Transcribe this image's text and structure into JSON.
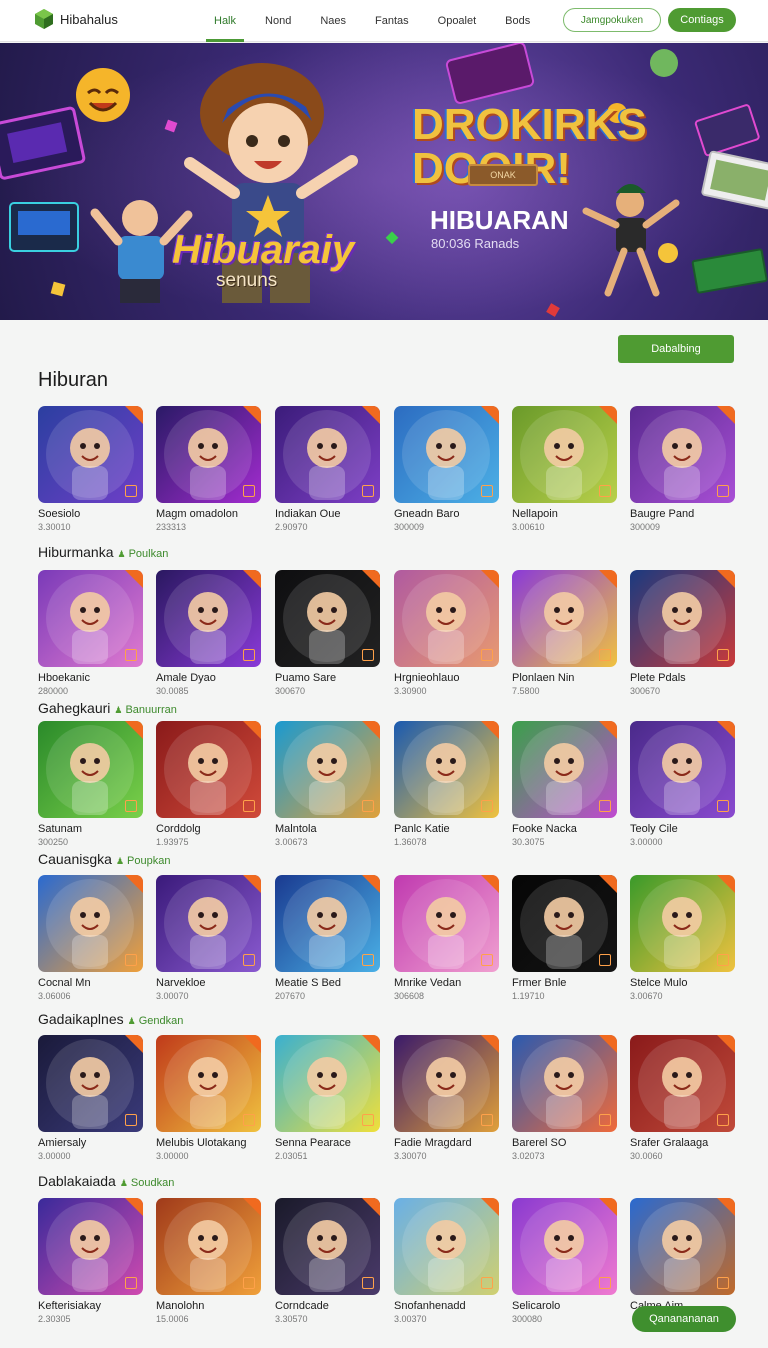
{
  "logo": {
    "name": "Hibahalus",
    "color": "#4f9b32"
  },
  "nav": {
    "items": [
      "Halk",
      "Nond",
      "Naes",
      "Fantas",
      "Opoalet",
      "Bods"
    ],
    "active_index": 0
  },
  "header_buttons": {
    "outline": "Jamgpokuken",
    "solid": "Contiags"
  },
  "hero": {
    "left_title": "Hibuaraiy",
    "left_sub": "senuns",
    "big_title_1": "DROKIRKS",
    "big_title_2": "DOOIR!",
    "sign": "ONAK",
    "title": "HIBUARAN",
    "subtitle": "80:036 Ranads",
    "colors": {
      "bg": "#3c2a76",
      "accent": "#f0c23f"
    }
  },
  "action_button": "Dabalbing",
  "main_title": "Hiburan",
  "sections": [
    {
      "title": "",
      "tag": "",
      "items": [
        {
          "name": "Soesiolo",
          "meta": "3.30010",
          "colors": [
            "#2b3fa0",
            "#6f3fc8"
          ],
          "art": "cursor-arrow"
        },
        {
          "name": "Magm omadolon",
          "meta": "233313",
          "colors": [
            "#2a1a66",
            "#a32cd0"
          ],
          "art": "galaxy-orb"
        },
        {
          "name": "Indiakan Oue",
          "meta": "2.90970",
          "colors": [
            "#3b1c7a",
            "#7e3fc6"
          ],
          "art": "cat-kid"
        },
        {
          "name": "Gneadn Baro",
          "meta": "300009",
          "colors": [
            "#2c6cc1",
            "#4cb0e6"
          ],
          "art": "NOSLUK"
        },
        {
          "name": "Nellapoin",
          "meta": "3.00610",
          "colors": [
            "#6a9a2a",
            "#b9d04a"
          ],
          "art": "boy"
        },
        {
          "name": "Baugre Pand",
          "meta": "300009",
          "colors": [
            "#5a2a90",
            "#a94fd6"
          ],
          "art": "kid-hat"
        }
      ]
    },
    {
      "title": "Hiburmanka",
      "tag": "Poulkan",
      "items": [
        {
          "name": "Hboekanic",
          "meta": "280000",
          "colors": [
            "#7a3ab8",
            "#e07ad0"
          ],
          "art": "boy-cat"
        },
        {
          "name": "Amale Dyao",
          "meta": "30.0085",
          "colors": [
            "#2a1860",
            "#8a3ad8"
          ],
          "art": "bear-face"
        },
        {
          "name": "Puamo Sare",
          "meta": "300670",
          "colors": [
            "#0e0e10",
            "#222"
          ],
          "art": "crayon"
        },
        {
          "name": "Hrgnieohlauo",
          "meta": "3.30900",
          "colors": [
            "#b05aa0",
            "#e89a70"
          ],
          "art": "runner"
        },
        {
          "name": "Plonlaen Nin",
          "meta": "7.5800",
          "colors": [
            "#8a3ad8",
            "#f0c23f"
          ],
          "art": "BANEPDNG"
        },
        {
          "name": "Plete Pdals",
          "meta": "300670",
          "colors": [
            "#1a3a80",
            "#c93a3a"
          ],
          "art": "guitar-kid"
        }
      ]
    },
    {
      "title": "Gahegkauri",
      "tag": "Banuurran",
      "items": [
        {
          "name": "Satunam",
          "meta": "300250",
          "colors": [
            "#2a8a2a",
            "#7ad04a"
          ],
          "art": "Vrghees"
        },
        {
          "name": "Corddolg",
          "meta": "1.93975",
          "colors": [
            "#8a1a1a",
            "#d04a3a"
          ],
          "art": "cat-girl"
        },
        {
          "name": "Malntola",
          "meta": "3.00673",
          "colors": [
            "#1a9ad0",
            "#e0a03a"
          ],
          "art": "Miove Daksor"
        },
        {
          "name": "Panlc Katie",
          "meta": "1.36078",
          "colors": [
            "#1a5ab0",
            "#f0c23f"
          ],
          "art": "WAIRED"
        },
        {
          "name": "Fooke Nacka",
          "meta": "30.3075",
          "colors": [
            "#3aa04a",
            "#c04ad0"
          ],
          "art": "Cire Case"
        },
        {
          "name": "Teoly Cile",
          "meta": "3.00000",
          "colors": [
            "#4a2a8a",
            "#8a4ad0"
          ],
          "art": "WAARE"
        }
      ]
    },
    {
      "title": "Cauanisgka",
      "tag": "Poupkan",
      "items": [
        {
          "name": "Cocnal Mn",
          "meta": "3.06006",
          "colors": [
            "#2a6ad0",
            "#f0a03a"
          ],
          "art": "bear-big"
        },
        {
          "name": "Narvekloe",
          "meta": "3.00070",
          "colors": [
            "#3a1a7a",
            "#8a5ad0"
          ],
          "art": "kid-wave"
        },
        {
          "name": "Meatie S Bed",
          "meta": "207670",
          "colors": [
            "#1a3a90",
            "#4ab0e6"
          ],
          "art": "blue-creature"
        },
        {
          "name": "Mnrike Vedan",
          "meta": "306608",
          "colors": [
            "#c03ab0",
            "#f0a0d0"
          ],
          "art": "orange-bear"
        },
        {
          "name": "Frmer Bnle",
          "meta": "1.19710",
          "colors": [
            "#060606",
            "#141414"
          ],
          "art": "BMCAMS"
        },
        {
          "name": "Stelce Mulo",
          "meta": "3.00670",
          "colors": [
            "#3a9a2a",
            "#f0c23f"
          ],
          "art": "Nelvexx"
        }
      ]
    },
    {
      "title": "Gadaikaplnes",
      "tag": "Gendkan",
      "items": [
        {
          "name": "Amiersaly",
          "meta": "3.00000",
          "colors": [
            "#1a1a3a",
            "#3a3a7a"
          ],
          "art": "Galerlcdo"
        },
        {
          "name": "Melubis Ulotakang",
          "meta": "3.00000",
          "colors": [
            "#c03a1a",
            "#f0c23f"
          ],
          "art": "Nelhunes"
        },
        {
          "name": "Senna Pearace",
          "meta": "2.03051",
          "colors": [
            "#3ab0d0",
            "#f0e03a"
          ],
          "art": "WAAAC"
        },
        {
          "name": "Fadie Mragdard",
          "meta": "3.30070",
          "colors": [
            "#3a1a6a",
            "#e0a03a"
          ],
          "art": "Hiivis"
        },
        {
          "name": "Barerel SO",
          "meta": "3.02073",
          "colors": [
            "#2a5ab0",
            "#f06a3a"
          ],
          "art": "kid-city"
        },
        {
          "name": "Srafer Gralaaga",
          "meta": "30.0060",
          "colors": [
            "#8a1a1a",
            "#c04a3a"
          ],
          "art": "kid-dark"
        }
      ]
    },
    {
      "title": "Dablakaiada",
      "tag": "Soudkan",
      "items": [
        {
          "name": "Kefterisiakay",
          "meta": "2.30305",
          "colors": [
            "#3a2a9a",
            "#d04ab0"
          ],
          "art": "HOPNBER"
        },
        {
          "name": "Manolohn",
          "meta": "15.0006",
          "colors": [
            "#a03a1a",
            "#f0a03a"
          ],
          "art": "girl-cookies"
        },
        {
          "name": "Corndcade",
          "meta": "3.30570",
          "colors": [
            "#1a1a2a",
            "#4a3a6a"
          ],
          "art": "NAME"
        },
        {
          "name": "Snofanhenadd",
          "meta": "3.00370",
          "colors": [
            "#6ab0e6",
            "#d0d070"
          ],
          "art": "dancer"
        },
        {
          "name": "Selicarolo",
          "meta": "300080",
          "colors": [
            "#8a3ad0",
            "#f07ad0"
          ],
          "art": "Bezty Colee"
        },
        {
          "name": "Calme Ajm",
          "meta": "",
          "colors": [
            "#2a6ad0",
            "#c06a2a"
          ],
          "art": "HBPARS"
        }
      ]
    }
  ],
  "float_button": "Qananananan"
}
